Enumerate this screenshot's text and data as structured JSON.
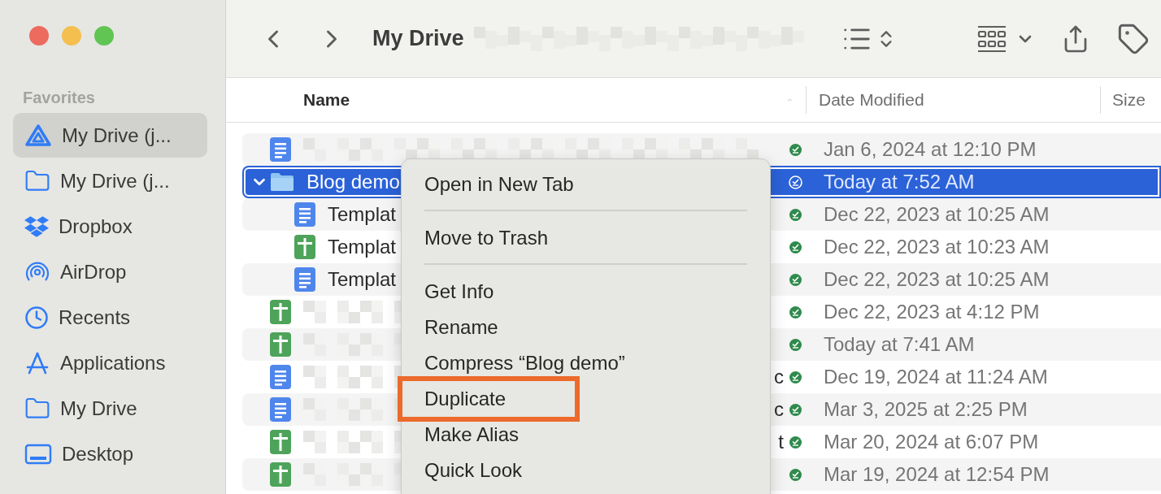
{
  "window": {
    "title": "My Drive"
  },
  "sidebar": {
    "heading": "Favorites",
    "items": [
      {
        "label": "My Drive (j...",
        "kind": "drive",
        "selected": true
      },
      {
        "label": "My Drive (j...",
        "kind": "folder",
        "selected": false
      },
      {
        "label": "Dropbox",
        "kind": "dropbox",
        "selected": false
      },
      {
        "label": "AirDrop",
        "kind": "airdrop",
        "selected": false
      },
      {
        "label": "Recents",
        "kind": "recents",
        "selected": false
      },
      {
        "label": "Applications",
        "kind": "applications",
        "selected": false
      },
      {
        "label": "My Drive",
        "kind": "folder",
        "selected": false
      },
      {
        "label": "Desktop",
        "kind": "desktop",
        "selected": false
      }
    ]
  },
  "table": {
    "columns": [
      "Name",
      "Date Modified",
      "Size"
    ],
    "rows": [
      {
        "kind": "doc",
        "redacted": true,
        "date": "Jan 6, 2024 at 12:10 PM",
        "selected": false
      },
      {
        "kind": "folder",
        "name": "Blog demo",
        "date": "Today at 7:52 AM",
        "selected": true,
        "expanded": true,
        "children": [
          {
            "kind": "doc",
            "name": "Templat",
            "date": "Dec 22, 2023 at 10:25 AM",
            "selected": false
          },
          {
            "kind": "sheet",
            "name": "Templat",
            "date": "Dec 22, 2023 at 10:23 AM",
            "selected": false
          },
          {
            "kind": "doc",
            "name": "Templat",
            "date": "Dec 22, 2023 at 10:25 AM",
            "selected": false
          }
        ]
      },
      {
        "kind": "sheet",
        "redacted": true,
        "date": "Dec 22, 2023 at 4:12 PM",
        "selected": false
      },
      {
        "kind": "sheet",
        "redacted": true,
        "date": "Today at 7:41 AM",
        "selected": false
      },
      {
        "kind": "doc",
        "redacted": true,
        "tail": "c",
        "date": "Dec 19, 2024 at 11:24 AM",
        "selected": false
      },
      {
        "kind": "doc",
        "redacted": true,
        "tail": "c",
        "date": "Mar 3, 2025 at 2:25 PM",
        "selected": false
      },
      {
        "kind": "sheet",
        "redacted": true,
        "tail": "t",
        "date": "Mar 20, 2024 at 6:07 PM",
        "selected": false
      },
      {
        "kind": "sheet",
        "redacted": true,
        "date": "Mar 19, 2024 at 12:54 PM",
        "selected": false
      }
    ]
  },
  "context_menu": {
    "groups": [
      [
        {
          "label": "Open in New Tab",
          "highlighted": false
        }
      ],
      [
        {
          "label": "Move to Trash",
          "highlighted": false
        }
      ],
      [
        {
          "label": "Get Info",
          "highlighted": false
        },
        {
          "label": "Rename",
          "highlighted": false
        },
        {
          "label": "Compress “Blog demo”",
          "highlighted": false
        },
        {
          "label": "Duplicate",
          "highlighted": true
        },
        {
          "label": "Make Alias",
          "highlighted": false
        },
        {
          "label": "Quick Look",
          "highlighted": false
        }
      ]
    ]
  }
}
